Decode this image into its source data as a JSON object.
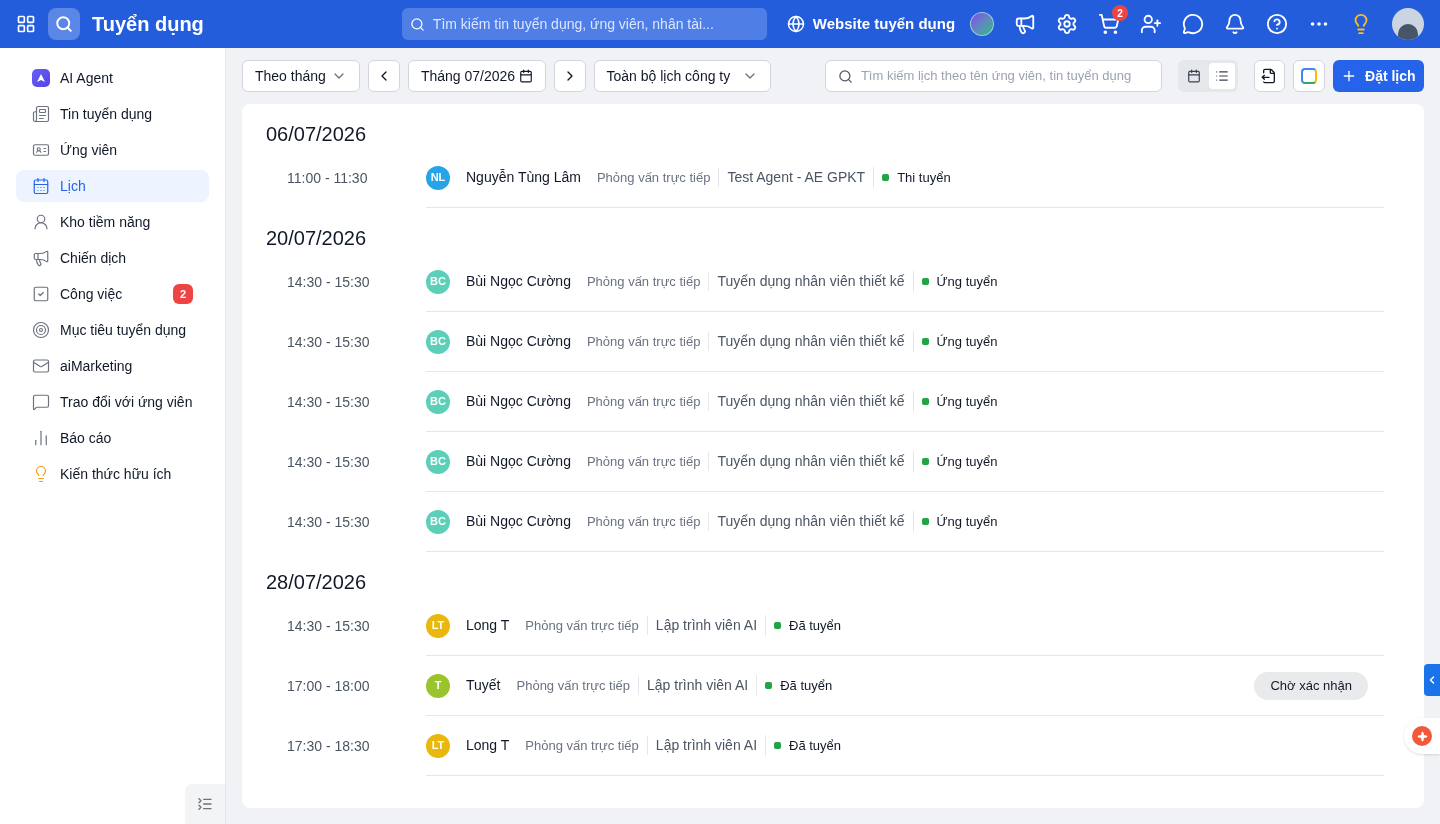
{
  "header": {
    "app_title": "Tuyển dụng",
    "search": {
      "placeholder": "Tìm kiếm tin tuyển dụng, ứng viên, nhân tài..."
    },
    "website_link": "Website tuyển dụng",
    "cart_badge": "2"
  },
  "sidebar": {
    "items": [
      {
        "label": "AI Agent",
        "kind": "agent",
        "selected": false
      },
      {
        "label": "Tin tuyển dụng",
        "kind": "news",
        "selected": false
      },
      {
        "label": "Ứng viên",
        "kind": "card",
        "selected": false
      },
      {
        "label": "Lịch",
        "kind": "calendar",
        "selected": true
      },
      {
        "label": "Kho tiềm năng",
        "kind": "user",
        "selected": false
      },
      {
        "label": "Chiến dịch",
        "kind": "megaphone",
        "selected": false
      },
      {
        "label": "Công việc",
        "kind": "check",
        "selected": false,
        "badge": "2"
      },
      {
        "label": "Mục tiêu tuyển dụng",
        "kind": "target",
        "selected": false
      },
      {
        "label": "aiMarketing",
        "kind": "mail",
        "selected": false
      },
      {
        "label": "Trao đổi với ứng viên",
        "kind": "chat",
        "selected": false
      },
      {
        "label": "Báo cáo",
        "kind": "chart",
        "selected": false
      },
      {
        "label": "Kiến thức hữu ích",
        "kind": "bulb",
        "selected": false
      }
    ]
  },
  "toolbar": {
    "period": "Theo tháng",
    "month": "Tháng 07/2026",
    "scope": "Toàn bộ lịch công ty",
    "search": {
      "placeholder": "Tìm kiếm lịch theo tên ứng viên, tin tuyển dụng"
    },
    "views": [
      {
        "kind": "calendar",
        "selected": false
      },
      {
        "kind": "list",
        "selected": true
      }
    ],
    "add_button": "Đặt lịch"
  },
  "schedule": [
    {
      "date": "06/07/2026",
      "events": [
        {
          "time": "11:00 - 11:30",
          "initials": "NL",
          "color": "#27a4e8",
          "name": "Nguyễn Tùng Lâm",
          "type": "Phỏng vấn trực tiếp",
          "job": "Test Agent - AE GPKT",
          "status": "Thi tuyển"
        }
      ]
    },
    {
      "date": "20/07/2026",
      "events": [
        {
          "time": "14:30 - 15:30",
          "initials": "BC",
          "color": "#5ccfb8",
          "name": "Bùi Ngọc Cường",
          "type": "Phỏng vấn trực tiếp",
          "job": "Tuyển dụng nhân viên thiết kế",
          "status": "Ứng tuyển"
        },
        {
          "time": "14:30 - 15:30",
          "initials": "BC",
          "color": "#5ccfb8",
          "name": "Bùi Ngọc Cường",
          "type": "Phỏng vấn trực tiếp",
          "job": "Tuyển dụng nhân viên thiết kế",
          "status": "Ứng tuyển"
        },
        {
          "time": "14:30 - 15:30",
          "initials": "BC",
          "color": "#5ccfb8",
          "name": "Bùi Ngọc Cường",
          "type": "Phỏng vấn trực tiếp",
          "job": "Tuyển dụng nhân viên thiết kế",
          "status": "Ứng tuyển"
        },
        {
          "time": "14:30 - 15:30",
          "initials": "BC",
          "color": "#5ccfb8",
          "name": "Bùi Ngọc Cường",
          "type": "Phỏng vấn trực tiếp",
          "job": "Tuyển dụng nhân viên thiết kế",
          "status": "Ứng tuyển"
        },
        {
          "time": "14:30 - 15:30",
          "initials": "BC",
          "color": "#5ccfb8",
          "name": "Bùi Ngọc Cường",
          "type": "Phỏng vấn trực tiếp",
          "job": "Tuyển dụng nhân viên thiết kế",
          "status": "Ứng tuyển"
        }
      ]
    },
    {
      "date": "28/07/2026",
      "events": [
        {
          "time": "14:30 - 15:30",
          "initials": "LT",
          "color": "#eab80c",
          "name": "Long T",
          "type": "Phỏng vấn trực tiếp",
          "job": "Lập trình viên AI",
          "status": "Đã tuyển"
        },
        {
          "time": "17:00 - 18:00",
          "initials": "T",
          "color": "#9ac42c",
          "name": "Tuyết",
          "type": "Phỏng vấn trực tiếp",
          "job": "Lập trình viên AI",
          "status": "Đã tuyển",
          "action": "Chờ xác nhận"
        },
        {
          "time": "17:30 - 18:30",
          "initials": "LT",
          "color": "#eab80c",
          "name": "Long T",
          "type": "Phỏng vấn trực tiếp",
          "job": "Lập trình viên AI",
          "status": "Đã tuyển"
        }
      ]
    }
  ]
}
